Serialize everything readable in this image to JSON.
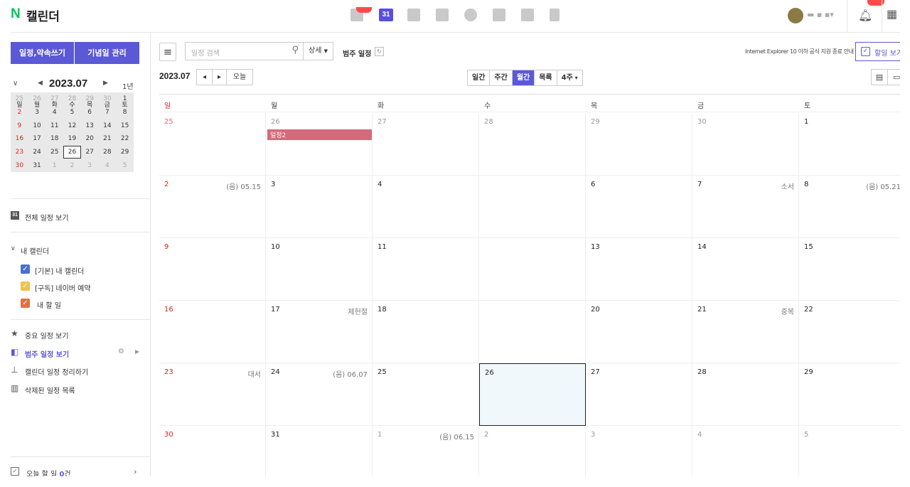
{
  "topbar": {
    "logo_n": "N",
    "logo_text": "캘린더",
    "calendar_app_label": "31",
    "user_name": "▬ ▪ ▪▾"
  },
  "sidebar": {
    "create_button": "일정,약속쓰기",
    "anniversary_button": "기념일 관리",
    "mini": {
      "title": "2023.07",
      "year_label": "1년",
      "weekdays": [
        "일",
        "월",
        "화",
        "수",
        "목",
        "금",
        "토"
      ],
      "weeks": [
        [
          "25",
          "26",
          "27",
          "28",
          "29",
          "30",
          "1"
        ],
        [
          "2",
          "3",
          "4",
          "5",
          "6",
          "7",
          "8"
        ],
        [
          "9",
          "10",
          "11",
          "12",
          "13",
          "14",
          "15"
        ],
        [
          "16",
          "17",
          "18",
          "19",
          "20",
          "21",
          "22"
        ],
        [
          "23",
          "24",
          "25",
          "26",
          "27",
          "28",
          "29"
        ],
        [
          "30",
          "31",
          "1",
          "2",
          "3",
          "4",
          "5"
        ]
      ]
    },
    "all_schedule": "전체 일정 보기",
    "all_icon": "31",
    "my_calendars_header": "내 캘린더",
    "calendars": [
      {
        "label": "[기본] 내 캘린더",
        "color": "#4a6fd0"
      },
      {
        "label": "[구독] 네이버 예약",
        "color": "#f0c14b"
      },
      {
        "label": "내 할 일",
        "color": "#e07142"
      }
    ],
    "menu": [
      {
        "label": "중요 일정 보기",
        "icon": "star-icon"
      },
      {
        "label": "범주 일정 보기",
        "icon": "category-icon"
      },
      {
        "label": "캘린더 일정 정리하기",
        "icon": "broom-icon"
      },
      {
        "label": "삭제된 일정 목록",
        "icon": "trash-icon"
      }
    ],
    "today_todo_prefix": "오늘 할 일 ",
    "today_todo_count": "0",
    "today_todo_suffix": "건"
  },
  "toolbar": {
    "search_placeholder": "일정 검색",
    "detail": "상세",
    "range_label": "범주 일정",
    "ie_notice": "Internet Explorer 10 이하 공식 지원 종료 안내",
    "todo_button": "할일 보기",
    "current_month": "2023.07",
    "today_button": "오늘",
    "views": [
      "일간",
      "주간",
      "월간",
      "목록",
      "4주"
    ],
    "active_view": "월간"
  },
  "calendar": {
    "weekdays": [
      "일",
      "월",
      "화",
      "수",
      "목",
      "금",
      "토"
    ],
    "weeks": [
      [
        {
          "d": "25",
          "o": true
        },
        {
          "d": "26",
          "o": true,
          "e": "일정2"
        },
        {
          "d": "27",
          "o": true
        },
        {
          "d": "28",
          "o": true
        },
        {
          "d": "29",
          "o": true
        },
        {
          "d": "30",
          "o": true
        },
        {
          "d": "1"
        }
      ],
      [
        {
          "d": "2",
          "n": "(음) 05.15"
        },
        {
          "d": "3"
        },
        {
          "d": "4"
        },
        {
          "d": ""
        },
        {
          "d": "6"
        },
        {
          "d": "7",
          "n": "소서"
        },
        {
          "d": "8",
          "n": "(음) 05.21"
        }
      ],
      [
        {
          "d": "9"
        },
        {
          "d": "10"
        },
        {
          "d": "11"
        },
        {
          "d": ""
        },
        {
          "d": "13"
        },
        {
          "d": "14"
        },
        {
          "d": "15"
        }
      ],
      [
        {
          "d": "16"
        },
        {
          "d": "17",
          "n": "제헌절"
        },
        {
          "d": "18"
        },
        {
          "d": ""
        },
        {
          "d": "20"
        },
        {
          "d": "21",
          "n": "중복"
        },
        {
          "d": "22"
        }
      ],
      [
        {
          "d": "23",
          "n": "대서"
        },
        {
          "d": "24",
          "n": "(음) 06.07"
        },
        {
          "d": "25"
        },
        {
          "d": "26",
          "t": true
        },
        {
          "d": "27"
        },
        {
          "d": "28"
        },
        {
          "d": "29"
        }
      ],
      [
        {
          "d": "30"
        },
        {
          "d": "31"
        },
        {
          "d": "1",
          "o": true,
          "n": "(음) 06.15"
        },
        {
          "d": "2",
          "o": true
        },
        {
          "d": "3",
          "o": true
        },
        {
          "d": "4",
          "o": true
        },
        {
          "d": "5",
          "o": true
        }
      ]
    ]
  }
}
